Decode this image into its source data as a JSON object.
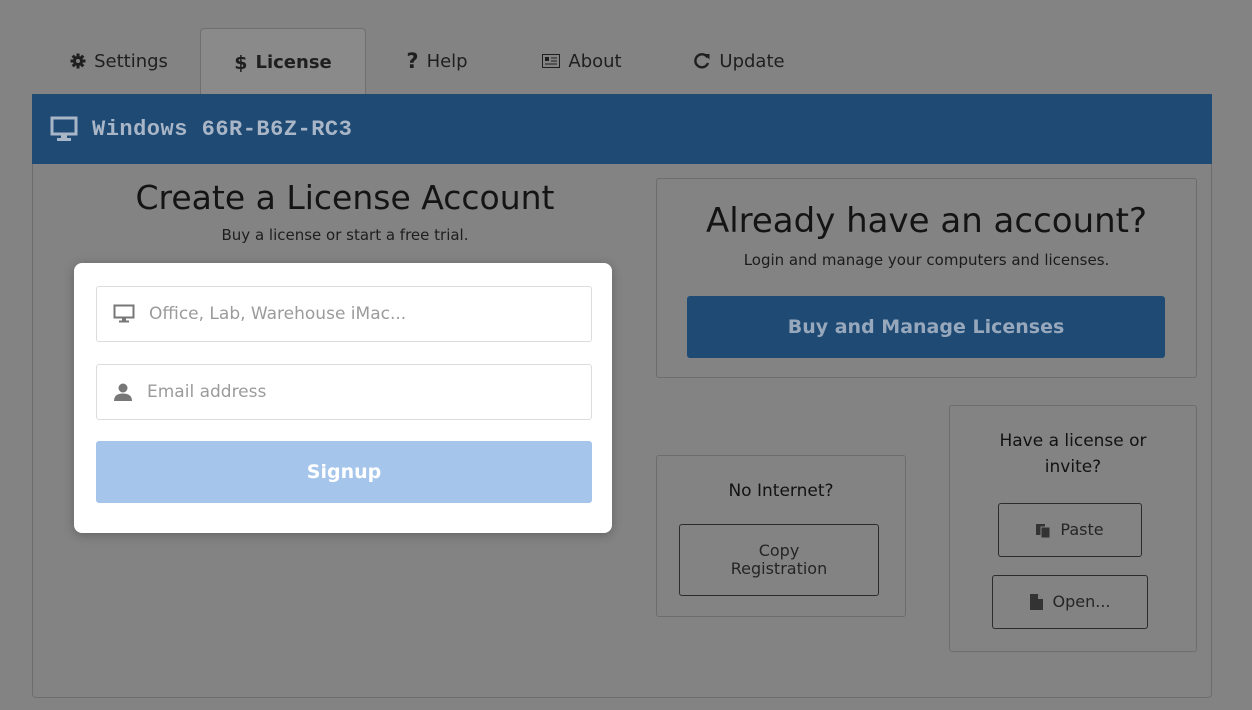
{
  "tabs": [
    {
      "label": "Settings",
      "icon": "gear-icon"
    },
    {
      "label": "License",
      "icon": "dollar-icon",
      "active": true
    },
    {
      "label": "Help",
      "icon": "question-icon"
    },
    {
      "label": "About",
      "icon": "id-card-icon"
    },
    {
      "label": "Update",
      "icon": "refresh-icon"
    }
  ],
  "header": {
    "title": "Windows 66R-B6Z-RC3",
    "icon": "monitor-icon",
    "color": "#1f4a74"
  },
  "create": {
    "title": "Create a License Account",
    "subtitle": "Buy a license or start a free trial.",
    "computer_name_placeholder": "Office, Lab, Warehouse iMac...",
    "email_placeholder": "Email address",
    "signup_label": "Signup",
    "signup_color": "#a5c6ea"
  },
  "account": {
    "title": "Already have an account?",
    "subtitle": "Login and manage your computers and licenses.",
    "buy_label": "Buy and Manage Licenses"
  },
  "offline": {
    "title": "No Internet?",
    "copy_line1": "Copy",
    "copy_line2": "Registration"
  },
  "license": {
    "title_line1": "Have a license or",
    "title_line2": "invite?",
    "paste_label": "Paste",
    "open_label": "Open..."
  }
}
